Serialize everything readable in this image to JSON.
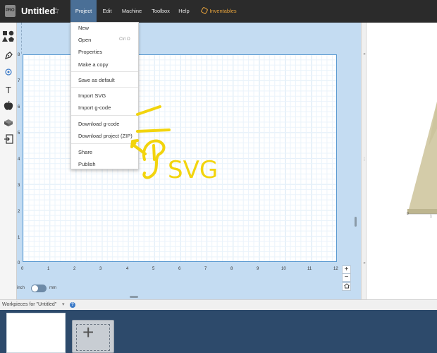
{
  "app": {
    "title": "Untitled",
    "star_icon": "star-outline-icon",
    "logo_text": "PRO"
  },
  "menubar": {
    "project": "Project",
    "edit": "Edit",
    "machine": "Machine",
    "toolbox": "Toolbox",
    "help": "Help",
    "inventables": "Inventables"
  },
  "project_menu": {
    "items": [
      {
        "label": "New"
      },
      {
        "label": "Open",
        "shortcut": "Ctrl O"
      },
      {
        "label": "Properties"
      },
      {
        "label": "Make a copy"
      },
      {
        "label": "Save as default"
      },
      {
        "label": "Import SVG"
      },
      {
        "label": "Import g-code"
      },
      {
        "label": "Download g-code"
      },
      {
        "label": "Download project (ZIP)"
      },
      {
        "label": "Share"
      },
      {
        "label": "Publish"
      }
    ]
  },
  "toolbar": {
    "icons": [
      "shapes-icon",
      "pen-icon",
      "target-icon",
      "text-icon",
      "apple-icon",
      "box-3d-icon",
      "import-icon"
    ],
    "text_tool_label": "T"
  },
  "canvas": {
    "y_ticks": [
      "8",
      "7",
      "6",
      "5",
      "4",
      "3",
      "2",
      "1",
      "0"
    ],
    "x_ticks": [
      "0",
      "1",
      "2",
      "3",
      "4",
      "5",
      "6",
      "7",
      "8",
      "9",
      "10",
      "11",
      "12"
    ],
    "units_left": "inch",
    "units_right": "mm",
    "zoom_in": "+",
    "zoom_out": "−",
    "home_icon": "home-icon"
  },
  "preview": {
    "axis_labels": [
      "0",
      "1"
    ]
  },
  "annotation": {
    "text": "SVG",
    "color": "#f2d40d"
  },
  "workpieces": {
    "label": "Workpieces for \"Untitled\"",
    "help": "?",
    "add_label": "+"
  }
}
